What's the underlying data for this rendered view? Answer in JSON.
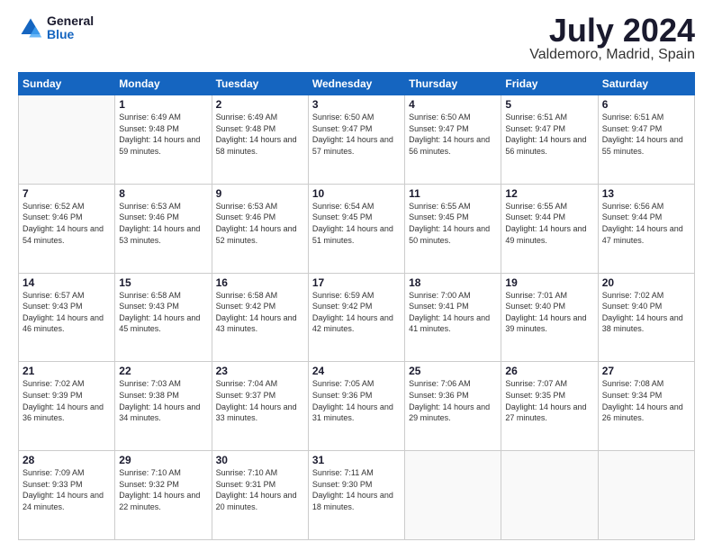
{
  "logo": {
    "line1": "General",
    "line2": "Blue"
  },
  "title": "July 2024",
  "subtitle": "Valdemoro, Madrid, Spain",
  "weekdays": [
    "Sunday",
    "Monday",
    "Tuesday",
    "Wednesday",
    "Thursday",
    "Friday",
    "Saturday"
  ],
  "weeks": [
    [
      {
        "day": "",
        "sunrise": "",
        "sunset": "",
        "daylight": ""
      },
      {
        "day": "1",
        "sunrise": "Sunrise: 6:49 AM",
        "sunset": "Sunset: 9:48 PM",
        "daylight": "Daylight: 14 hours and 59 minutes."
      },
      {
        "day": "2",
        "sunrise": "Sunrise: 6:49 AM",
        "sunset": "Sunset: 9:48 PM",
        "daylight": "Daylight: 14 hours and 58 minutes."
      },
      {
        "day": "3",
        "sunrise": "Sunrise: 6:50 AM",
        "sunset": "Sunset: 9:47 PM",
        "daylight": "Daylight: 14 hours and 57 minutes."
      },
      {
        "day": "4",
        "sunrise": "Sunrise: 6:50 AM",
        "sunset": "Sunset: 9:47 PM",
        "daylight": "Daylight: 14 hours and 56 minutes."
      },
      {
        "day": "5",
        "sunrise": "Sunrise: 6:51 AM",
        "sunset": "Sunset: 9:47 PM",
        "daylight": "Daylight: 14 hours and 56 minutes."
      },
      {
        "day": "6",
        "sunrise": "Sunrise: 6:51 AM",
        "sunset": "Sunset: 9:47 PM",
        "daylight": "Daylight: 14 hours and 55 minutes."
      }
    ],
    [
      {
        "day": "7",
        "sunrise": "Sunrise: 6:52 AM",
        "sunset": "Sunset: 9:46 PM",
        "daylight": "Daylight: 14 hours and 54 minutes."
      },
      {
        "day": "8",
        "sunrise": "Sunrise: 6:53 AM",
        "sunset": "Sunset: 9:46 PM",
        "daylight": "Daylight: 14 hours and 53 minutes."
      },
      {
        "day": "9",
        "sunrise": "Sunrise: 6:53 AM",
        "sunset": "Sunset: 9:46 PM",
        "daylight": "Daylight: 14 hours and 52 minutes."
      },
      {
        "day": "10",
        "sunrise": "Sunrise: 6:54 AM",
        "sunset": "Sunset: 9:45 PM",
        "daylight": "Daylight: 14 hours and 51 minutes."
      },
      {
        "day": "11",
        "sunrise": "Sunrise: 6:55 AM",
        "sunset": "Sunset: 9:45 PM",
        "daylight": "Daylight: 14 hours and 50 minutes."
      },
      {
        "day": "12",
        "sunrise": "Sunrise: 6:55 AM",
        "sunset": "Sunset: 9:44 PM",
        "daylight": "Daylight: 14 hours and 49 minutes."
      },
      {
        "day": "13",
        "sunrise": "Sunrise: 6:56 AM",
        "sunset": "Sunset: 9:44 PM",
        "daylight": "Daylight: 14 hours and 47 minutes."
      }
    ],
    [
      {
        "day": "14",
        "sunrise": "Sunrise: 6:57 AM",
        "sunset": "Sunset: 9:43 PM",
        "daylight": "Daylight: 14 hours and 46 minutes."
      },
      {
        "day": "15",
        "sunrise": "Sunrise: 6:58 AM",
        "sunset": "Sunset: 9:43 PM",
        "daylight": "Daylight: 14 hours and 45 minutes."
      },
      {
        "day": "16",
        "sunrise": "Sunrise: 6:58 AM",
        "sunset": "Sunset: 9:42 PM",
        "daylight": "Daylight: 14 hours and 43 minutes."
      },
      {
        "day": "17",
        "sunrise": "Sunrise: 6:59 AM",
        "sunset": "Sunset: 9:42 PM",
        "daylight": "Daylight: 14 hours and 42 minutes."
      },
      {
        "day": "18",
        "sunrise": "Sunrise: 7:00 AM",
        "sunset": "Sunset: 9:41 PM",
        "daylight": "Daylight: 14 hours and 41 minutes."
      },
      {
        "day": "19",
        "sunrise": "Sunrise: 7:01 AM",
        "sunset": "Sunset: 9:40 PM",
        "daylight": "Daylight: 14 hours and 39 minutes."
      },
      {
        "day": "20",
        "sunrise": "Sunrise: 7:02 AM",
        "sunset": "Sunset: 9:40 PM",
        "daylight": "Daylight: 14 hours and 38 minutes."
      }
    ],
    [
      {
        "day": "21",
        "sunrise": "Sunrise: 7:02 AM",
        "sunset": "Sunset: 9:39 PM",
        "daylight": "Daylight: 14 hours and 36 minutes."
      },
      {
        "day": "22",
        "sunrise": "Sunrise: 7:03 AM",
        "sunset": "Sunset: 9:38 PM",
        "daylight": "Daylight: 14 hours and 34 minutes."
      },
      {
        "day": "23",
        "sunrise": "Sunrise: 7:04 AM",
        "sunset": "Sunset: 9:37 PM",
        "daylight": "Daylight: 14 hours and 33 minutes."
      },
      {
        "day": "24",
        "sunrise": "Sunrise: 7:05 AM",
        "sunset": "Sunset: 9:36 PM",
        "daylight": "Daylight: 14 hours and 31 minutes."
      },
      {
        "day": "25",
        "sunrise": "Sunrise: 7:06 AM",
        "sunset": "Sunset: 9:36 PM",
        "daylight": "Daylight: 14 hours and 29 minutes."
      },
      {
        "day": "26",
        "sunrise": "Sunrise: 7:07 AM",
        "sunset": "Sunset: 9:35 PM",
        "daylight": "Daylight: 14 hours and 27 minutes."
      },
      {
        "day": "27",
        "sunrise": "Sunrise: 7:08 AM",
        "sunset": "Sunset: 9:34 PM",
        "daylight": "Daylight: 14 hours and 26 minutes."
      }
    ],
    [
      {
        "day": "28",
        "sunrise": "Sunrise: 7:09 AM",
        "sunset": "Sunset: 9:33 PM",
        "daylight": "Daylight: 14 hours and 24 minutes."
      },
      {
        "day": "29",
        "sunrise": "Sunrise: 7:10 AM",
        "sunset": "Sunset: 9:32 PM",
        "daylight": "Daylight: 14 hours and 22 minutes."
      },
      {
        "day": "30",
        "sunrise": "Sunrise: 7:10 AM",
        "sunset": "Sunset: 9:31 PM",
        "daylight": "Daylight: 14 hours and 20 minutes."
      },
      {
        "day": "31",
        "sunrise": "Sunrise: 7:11 AM",
        "sunset": "Sunset: 9:30 PM",
        "daylight": "Daylight: 14 hours and 18 minutes."
      },
      {
        "day": "",
        "sunrise": "",
        "sunset": "",
        "daylight": ""
      },
      {
        "day": "",
        "sunrise": "",
        "sunset": "",
        "daylight": ""
      },
      {
        "day": "",
        "sunrise": "",
        "sunset": "",
        "daylight": ""
      }
    ]
  ]
}
